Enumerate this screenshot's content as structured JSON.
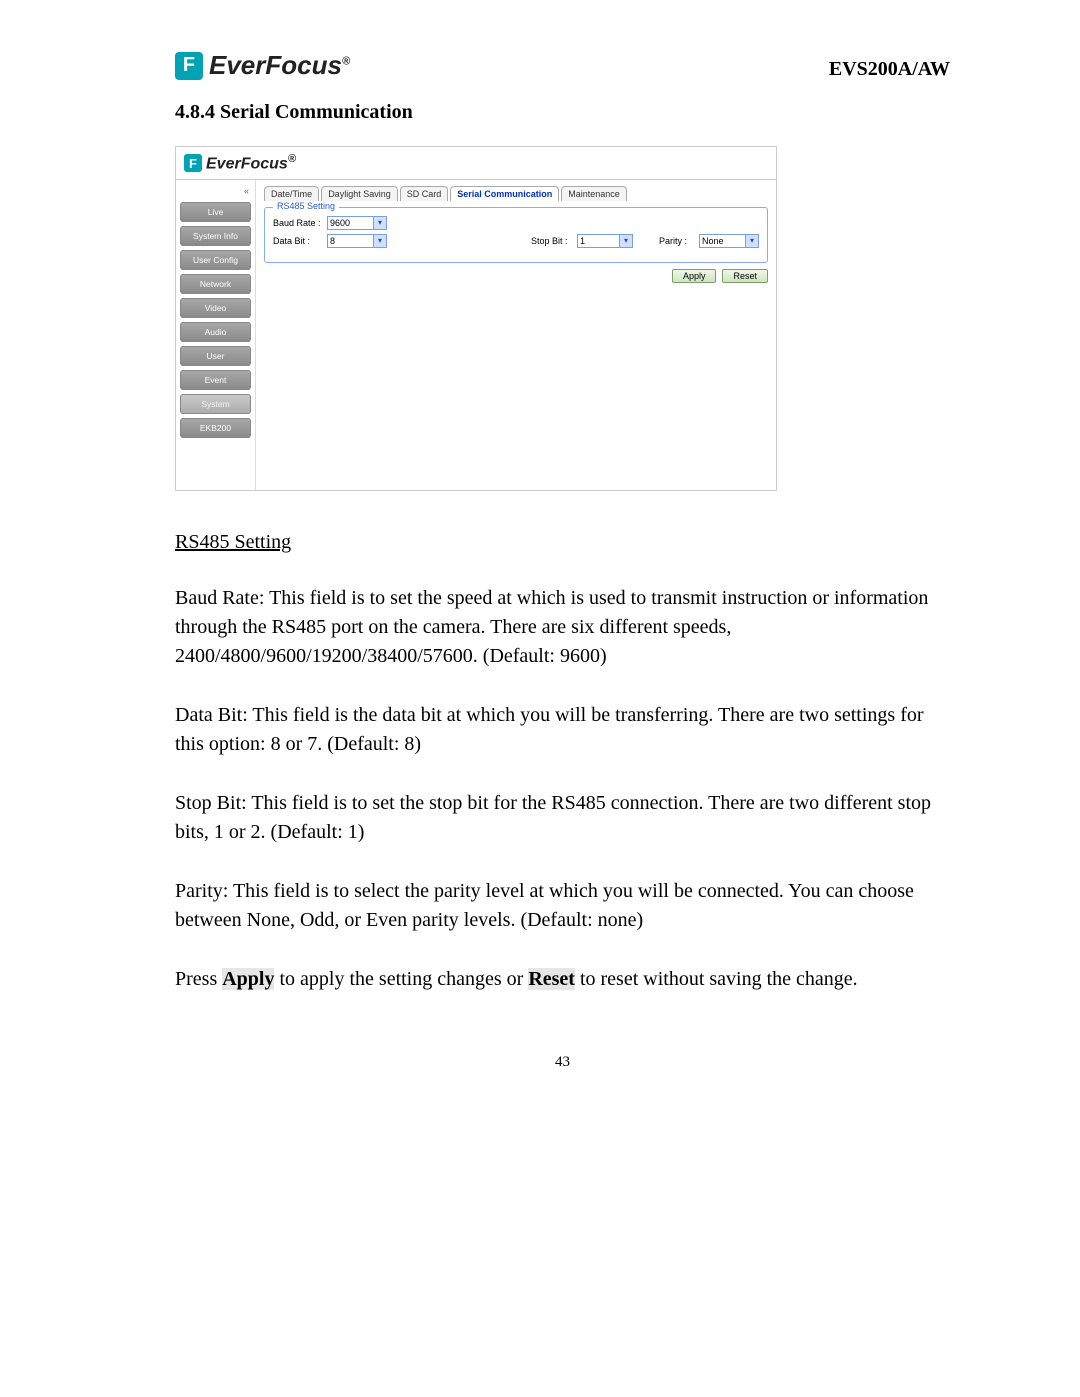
{
  "header": {
    "brand": "EverFocus",
    "model": "EVS200A/AW"
  },
  "section": {
    "number_title": "4.8.4 Serial Communication"
  },
  "screenshot": {
    "brand": "EverFocus",
    "sidebar": {
      "collapse": "«",
      "items": [
        "Live",
        "System Info",
        "User Config",
        "Network",
        "Video",
        "Audio",
        "User",
        "Event",
        "System",
        "EKB200"
      ]
    },
    "tabs": [
      "Date/Time",
      "Daylight Saving",
      "SD Card",
      "Serial Communication",
      "Maintenance"
    ],
    "active_tab_index": 3,
    "fieldset": {
      "legend": "RS485 Setting",
      "baud_label": "Baud Rate :",
      "baud_value": "9600",
      "data_label": "Data Bit :",
      "data_value": "8",
      "stop_label": "Stop Bit :",
      "stop_value": "1",
      "parity_label": "Parity :",
      "parity_value": "None",
      "apply": "Apply",
      "reset": "Reset"
    }
  },
  "body": {
    "subhead": "RS485 Setting",
    "p1": "Baud Rate: This field is to set the speed at which is used to transmit instruction or information through the RS485 port on the camera. There are six different speeds, 2400/4800/9600/19200/38400/57600. (Default: 9600)",
    "p2": "Data Bit: This field is the data bit at which you will be transferring. There are two settings for this option: 8 or 7. (Default: 8)",
    "p3": "Stop Bit: This field is to set the stop bit for the RS485 connection. There are two different stop bits, 1 or 2. (Default: 1)",
    "p4": "Parity: This field is to select the parity level at which you will be connected. You can choose between None, Odd, or Even parity levels. (Default: none)",
    "p5_pre": "Press ",
    "p5_apply": "Apply",
    "p5_mid": " to apply the setting changes or ",
    "p5_reset": "Reset",
    "p5_post": " to reset without saving the change."
  },
  "page_number": "43"
}
